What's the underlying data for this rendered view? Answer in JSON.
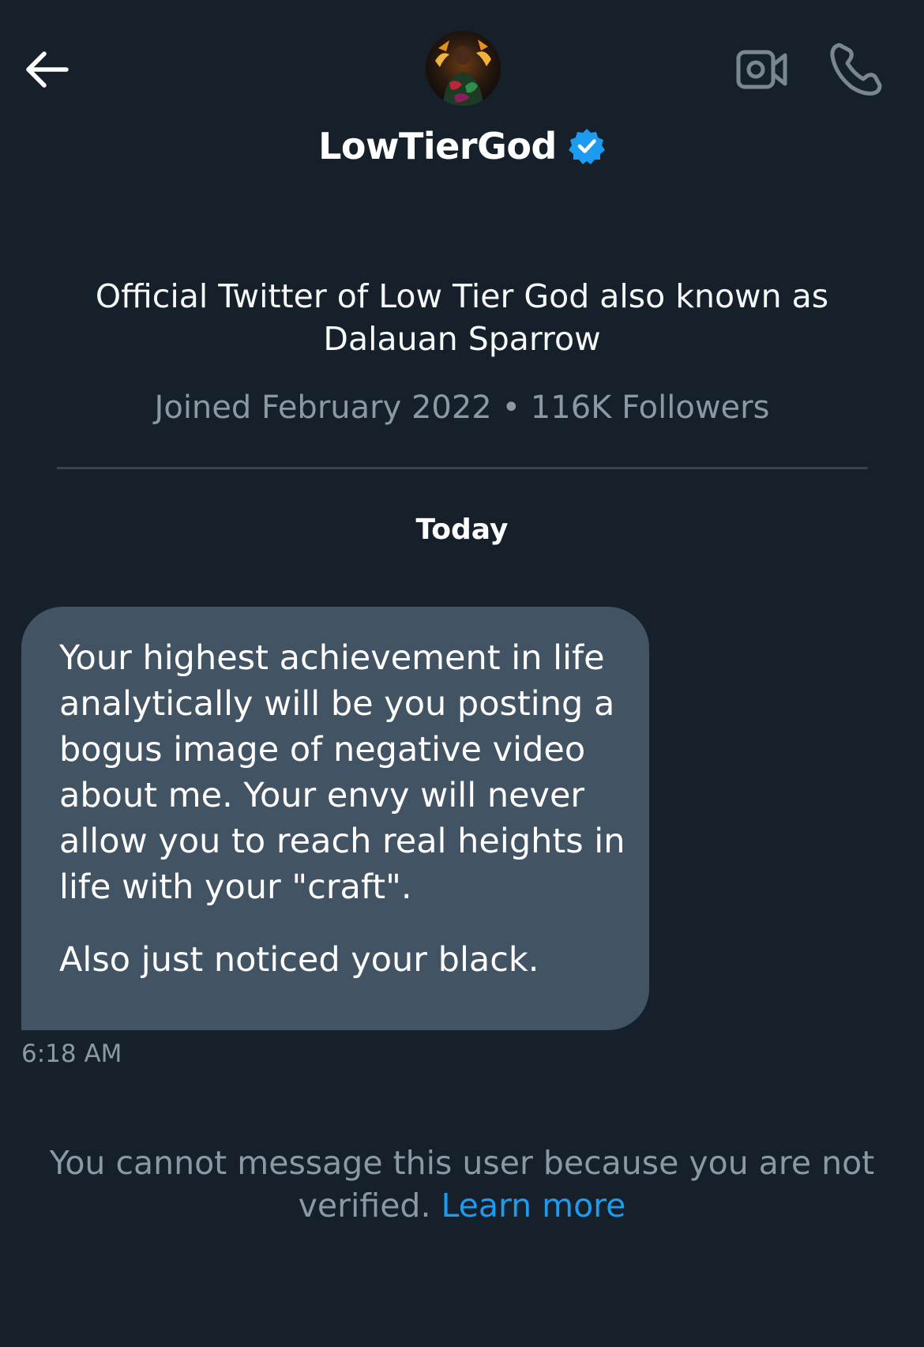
{
  "header": {
    "back_icon": "arrow-left-icon",
    "video_icon": "video-camera-icon",
    "phone_icon": "phone-icon",
    "avatar_icon": "profile-avatar"
  },
  "profile": {
    "display_name": "LowTierGod",
    "verified_icon": "verified-badge-icon",
    "verified_color": "#1d9bf0",
    "bio": "Official Twitter of Low Tier God also known as Dalauan Sparrow",
    "joined": "Joined February 2022",
    "separator": "•",
    "followers": "116K Followers"
  },
  "conversation": {
    "day_label": "Today",
    "messages": [
      {
        "paragraphs": [
          "Your highest achievement in life analytically will be you posting a bogus image of negative video about me. Your envy will never allow you to reach real heights in life with your \"craft\".",
          "Also just noticed your black."
        ],
        "time": "6:18 AM"
      }
    ]
  },
  "footer": {
    "notice_text": "You cannot message this user because you are not verified.",
    "learn_more_label": "Learn more",
    "link_color": "#1d9bf0"
  },
  "colors": {
    "background": "#15202b",
    "bubble": "#425364",
    "secondary_text": "#8b98a5",
    "divider": "#38444d"
  }
}
